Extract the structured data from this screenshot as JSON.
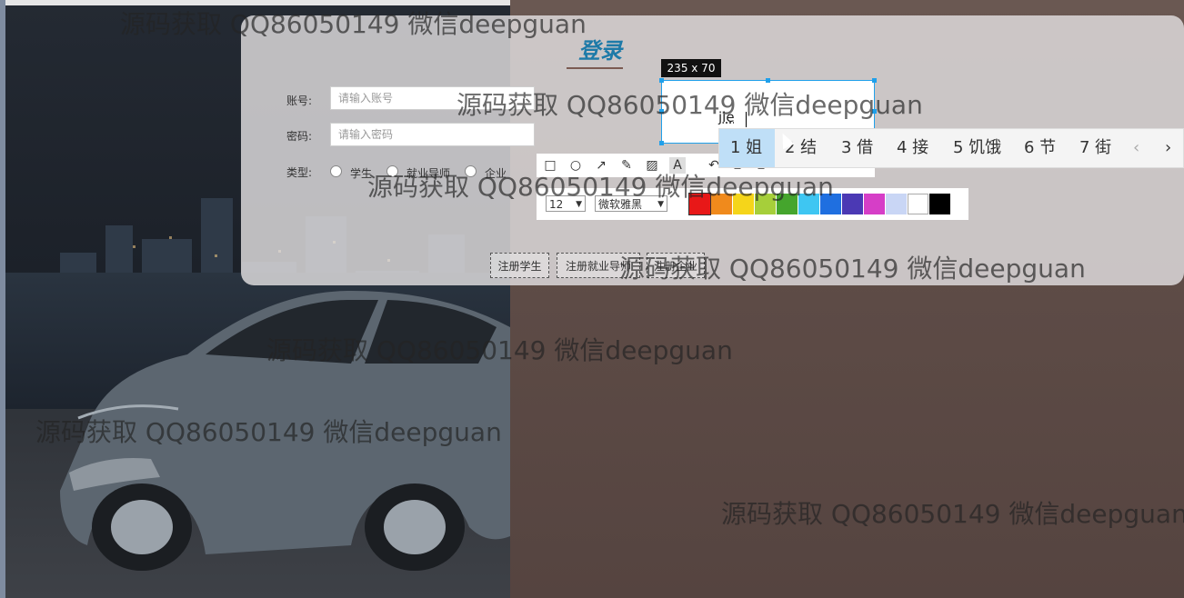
{
  "login": {
    "title": "登录",
    "account_label": "账号:",
    "account_placeholder": "请输入账号",
    "password_label": "密码:",
    "password_placeholder": "请输入密码",
    "type_label": "类型:",
    "types": [
      "学生",
      "就业导师",
      "企业"
    ],
    "register_buttons": [
      "注册学生",
      "注册就业导师",
      "注册企业"
    ]
  },
  "screenshot_tool": {
    "selection_size": "235 x 70",
    "ime_text": "jie",
    "font_size": "12",
    "font_family": "微软雅黑",
    "colors": [
      "#e81818",
      "#f08a1c",
      "#f5d51a",
      "#a6cf3a",
      "#45a52d",
      "#3ec6f2",
      "#1f6fe0",
      "#4b39b4",
      "#d63ec7",
      "#c9d6f5",
      "#ffffff",
      "#000000"
    ],
    "selected_color": "#e81818"
  },
  "ime": {
    "candidates": [
      "1 姐",
      "2 结",
      "3 借",
      "4 接",
      "5 饥饿",
      "6 节",
      "7 街"
    ],
    "prev": "‹",
    "next": "›"
  },
  "watermark": "源码获取 QQ86050149 微信deepguan"
}
